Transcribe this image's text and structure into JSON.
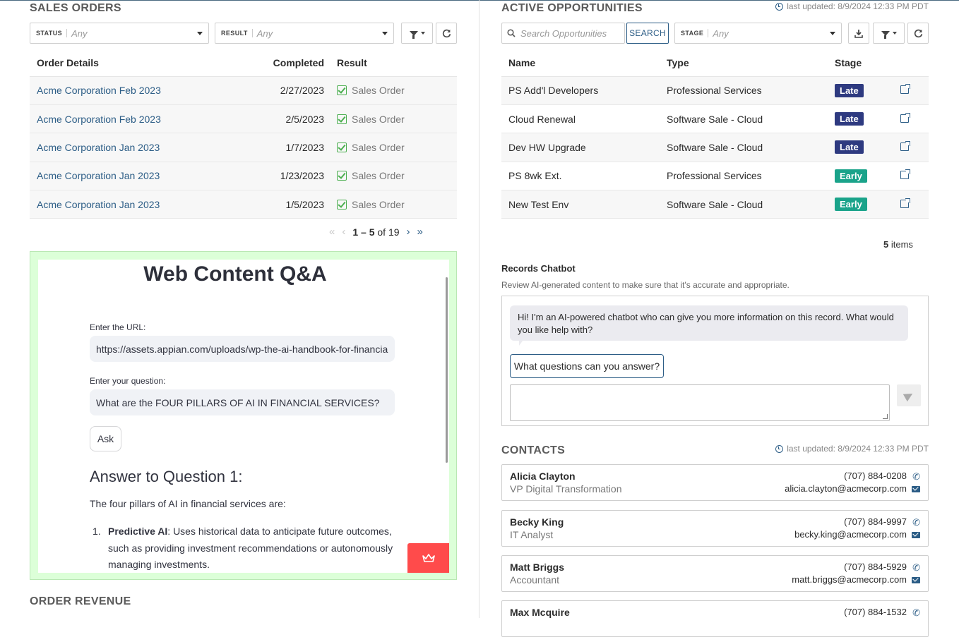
{
  "sales_orders": {
    "title": "SALES ORDERS",
    "filters": {
      "status_label": "STATUS",
      "status_value": "Any",
      "result_label": "RESULT",
      "result_value": "Any"
    },
    "columns": [
      "Order Details",
      "Completed",
      "Result"
    ],
    "rows": [
      {
        "details": "Acme Corporation Feb 2023",
        "completed": "2/27/2023",
        "result": "Sales Order"
      },
      {
        "details": "Acme Corporation Feb 2023",
        "completed": "2/5/2023",
        "result": "Sales Order"
      },
      {
        "details": "Acme Corporation Jan 2023",
        "completed": "1/7/2023",
        "result": "Sales Order"
      },
      {
        "details": "Acme Corporation Jan 2023",
        "completed": "1/23/2023",
        "result": "Sales Order"
      },
      {
        "details": "Acme Corporation Jan 2023",
        "completed": "1/5/2023",
        "result": "Sales Order"
      }
    ],
    "pager": {
      "range": "1 – 5",
      "of": "of 19"
    }
  },
  "web_qa": {
    "title": "Web Content Q&A",
    "url_label": "Enter the URL:",
    "url_value": "https://assets.appian.com/uploads/wp-the-ai-handbook-for-financia",
    "question_label": "Enter your question:",
    "question_value": "What are the FOUR PILLARS OF AI IN FINANCIAL SERVICES?",
    "ask_label": "Ask",
    "answer_heading": "Answer to Question 1:",
    "answer_intro": "The four pillars of AI in financial services are:",
    "answer_items": [
      {
        "num": "1.",
        "term": "Predictive AI",
        "text": ": Uses historical data to anticipate future outcomes, such as providing investment recommendations or autonomously managing investments."
      }
    ]
  },
  "order_revenue": {
    "title": "ORDER REVENUE"
  },
  "opportunities": {
    "title": "ACTIVE OPPORTUNITIES",
    "last_updated": "last updated: 8/9/2024 12:33 PM PDT",
    "search_placeholder": "Search Opportunities",
    "search_button": "SEARCH",
    "stage_label": "STAGE",
    "stage_value": "Any",
    "columns": [
      "Name",
      "Type",
      "Stage"
    ],
    "rows": [
      {
        "name": "PS Add'l Developers",
        "type": "Professional Services",
        "stage": "Late"
      },
      {
        "name": "Cloud Renewal",
        "type": "Software Sale - Cloud",
        "stage": "Late"
      },
      {
        "name": "Dev HW Upgrade",
        "type": "Software Sale - Cloud",
        "stage": "Late"
      },
      {
        "name": "PS 8wk Ext.",
        "type": "Professional Services",
        "stage": "Early"
      },
      {
        "name": "New Test Env",
        "type": "Software Sale - Cloud",
        "stage": "Early"
      }
    ],
    "items_count": "5",
    "items_label": "items",
    "stage_colors": {
      "Late": "#2e3a80",
      "Early": "#1aa38a"
    }
  },
  "chatbot": {
    "title": "Records Chatbot",
    "subtitle": "Review AI-generated content to make sure that it's accurate and appropriate.",
    "greeting": "Hi! I'm an AI-powered chatbot who can give you more information on this record. What would you like help with?",
    "suggestion": "What questions can you answer?"
  },
  "contacts": {
    "title": "CONTACTS",
    "last_updated": "last updated: 8/9/2024 12:33 PM PDT",
    "items": [
      {
        "name": "Alicia Clayton",
        "role": "VP Digital Transformation",
        "phone": "(707) 884-0208",
        "email": "alicia.clayton@acmecorp.com"
      },
      {
        "name": "Becky King",
        "role": "IT Analyst",
        "phone": "(707) 884-9997",
        "email": "becky.king@acmecorp.com"
      },
      {
        "name": "Matt Briggs",
        "role": "Accountant",
        "phone": "(707) 884-5929",
        "email": "matt.briggs@acmecorp.com"
      },
      {
        "name": "Max Mcquire",
        "role": "",
        "phone": "(707) 884-1532",
        "email": ""
      }
    ]
  },
  "colors": {
    "accent": "#2c5d86",
    "streamlit_red": "#ff4b4b",
    "widget_border_bg": "#dcffd8"
  }
}
